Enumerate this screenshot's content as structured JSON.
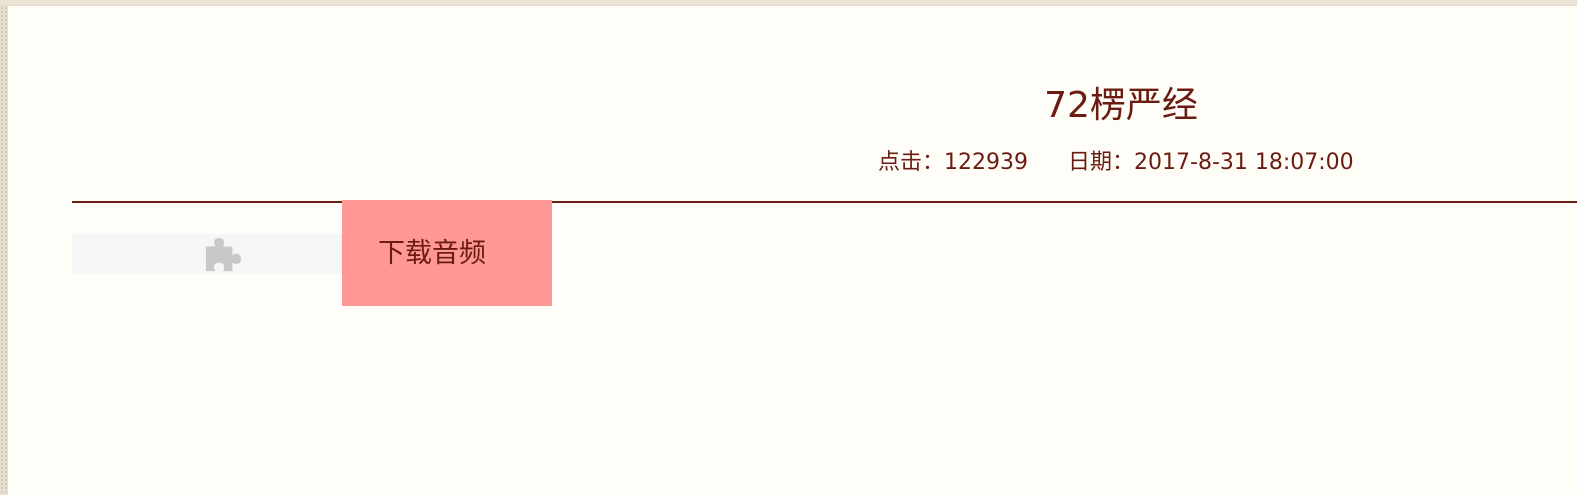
{
  "article": {
    "title": "72楞严经",
    "clicks_label": "点击：",
    "clicks_value": "122939",
    "date_label": "日期：",
    "date_value": "2017-8-31 18:07:00"
  },
  "plugin": {
    "icon": "puzzle-piece-icon"
  },
  "download": {
    "label": "下载音频"
  },
  "colors": {
    "text": "#6b1c12",
    "download_bg": "#ff9797",
    "page_bg": "#fffdf7"
  }
}
